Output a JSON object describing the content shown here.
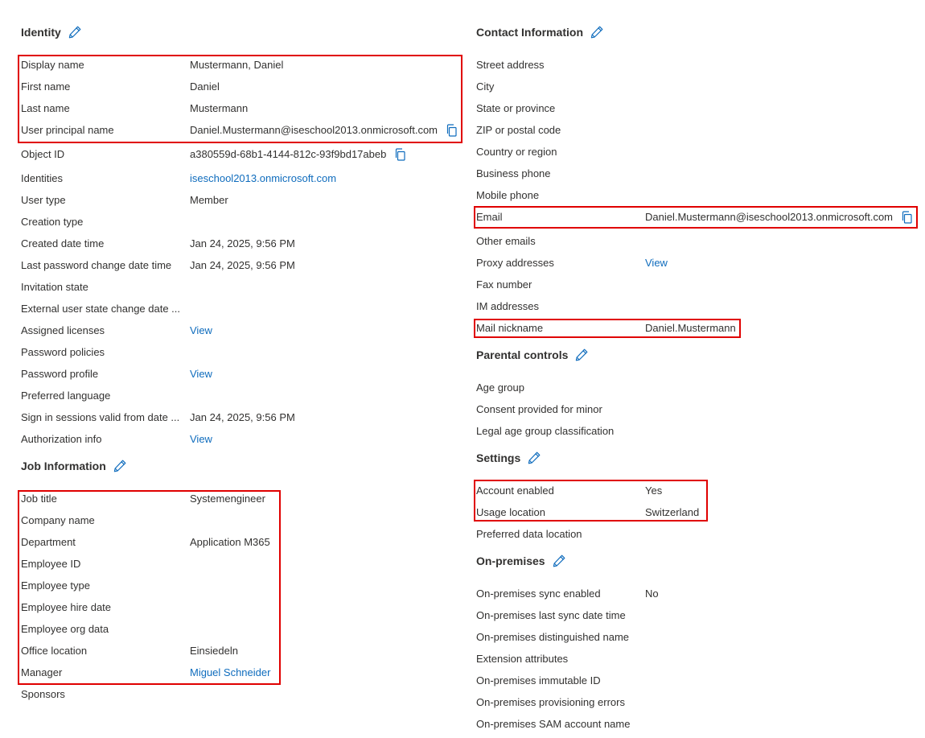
{
  "identity": {
    "title": "Identity",
    "rows": [
      {
        "label": "Display name",
        "value": "Mustermann, Daniel"
      },
      {
        "label": "First name",
        "value": "Daniel"
      },
      {
        "label": "Last name",
        "value": "Mustermann"
      },
      {
        "label": "User principal name",
        "value": "Daniel.Mustermann@iseschool2013.onmicrosoft.com"
      },
      {
        "label": "Object ID",
        "value": "a380559d-68b1-4144-812c-93f9bd17abeb"
      },
      {
        "label": "Identities",
        "value": "iseschool2013.onmicrosoft.com"
      },
      {
        "label": "User type",
        "value": "Member"
      },
      {
        "label": "Creation type",
        "value": ""
      },
      {
        "label": "Created date time",
        "value": "Jan 24, 2025, 9:56 PM"
      },
      {
        "label": "Last password change date time",
        "value": "Jan 24, 2025, 9:56 PM"
      },
      {
        "label": "Invitation state",
        "value": ""
      },
      {
        "label": "External user state change date ...",
        "value": ""
      },
      {
        "label": "Assigned licenses",
        "value": "View"
      },
      {
        "label": "Password policies",
        "value": ""
      },
      {
        "label": "Password profile",
        "value": "View"
      },
      {
        "label": "Preferred language",
        "value": ""
      },
      {
        "label": "Sign in sessions valid from date ...",
        "value": "Jan 24, 2025, 9:56 PM"
      },
      {
        "label": "Authorization info",
        "value": "View"
      }
    ]
  },
  "job": {
    "title": "Job Information",
    "rows": [
      {
        "label": "Job title",
        "value": "Systemengineer"
      },
      {
        "label": "Company name",
        "value": ""
      },
      {
        "label": "Department",
        "value": "Application M365"
      },
      {
        "label": "Employee ID",
        "value": ""
      },
      {
        "label": "Employee type",
        "value": ""
      },
      {
        "label": "Employee hire date",
        "value": ""
      },
      {
        "label": "Employee org data",
        "value": ""
      },
      {
        "label": "Office location",
        "value": "Einsiedeln"
      },
      {
        "label": "Manager",
        "value": "Miguel Schneider"
      },
      {
        "label": "Sponsors",
        "value": ""
      }
    ]
  },
  "contact": {
    "title": "Contact Information",
    "rows": [
      {
        "label": "Street address",
        "value": ""
      },
      {
        "label": "City",
        "value": ""
      },
      {
        "label": "State or province",
        "value": ""
      },
      {
        "label": "ZIP or postal code",
        "value": ""
      },
      {
        "label": "Country or region",
        "value": ""
      },
      {
        "label": "Business phone",
        "value": ""
      },
      {
        "label": "Mobile phone",
        "value": ""
      },
      {
        "label": "Email",
        "value": "Daniel.Mustermann@iseschool2013.onmicrosoft.com"
      },
      {
        "label": "Other emails",
        "value": ""
      },
      {
        "label": "Proxy addresses",
        "value": "View"
      },
      {
        "label": "Fax number",
        "value": ""
      },
      {
        "label": "IM addresses",
        "value": ""
      },
      {
        "label": "Mail nickname",
        "value": "Daniel.Mustermann"
      }
    ]
  },
  "parental": {
    "title": "Parental controls",
    "rows": [
      {
        "label": "Age group",
        "value": ""
      },
      {
        "label": "Consent provided for minor",
        "value": ""
      },
      {
        "label": "Legal age group classification",
        "value": ""
      }
    ]
  },
  "settings": {
    "title": "Settings",
    "rows": [
      {
        "label": "Account enabled",
        "value": "Yes"
      },
      {
        "label": "Usage location",
        "value": "Switzerland"
      },
      {
        "label": "Preferred data location",
        "value": ""
      }
    ]
  },
  "onprem": {
    "title": "On-premises",
    "rows": [
      {
        "label": "On-premises sync enabled",
        "value": "No"
      },
      {
        "label": "On-premises last sync date time",
        "value": ""
      },
      {
        "label": "On-premises distinguished name",
        "value": ""
      },
      {
        "label": "Extension attributes",
        "value": ""
      },
      {
        "label": "On-premises immutable ID",
        "value": ""
      },
      {
        "label": "On-premises provisioning errors",
        "value": ""
      },
      {
        "label": "On-premises SAM account name",
        "value": ""
      }
    ]
  },
  "icons": {
    "edit": "pencil-icon",
    "copy": "copy-icon"
  },
  "colors": {
    "link": "#0f6cbd",
    "highlight": "#e00000",
    "text": "#323130"
  }
}
